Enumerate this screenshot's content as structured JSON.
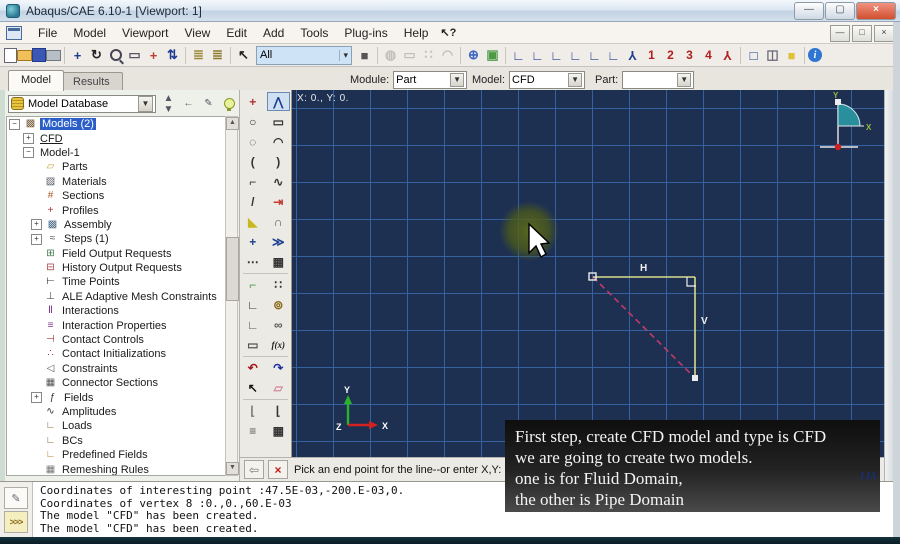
{
  "window": {
    "title": "Abaqus/CAE 6.10-1 [Viewport: 1]"
  },
  "menu_bar": {
    "items": [
      "File",
      "Model",
      "Viewport",
      "View",
      "Edit",
      "Add",
      "Tools",
      "Plug-ins",
      "Help"
    ],
    "context_help": "?"
  },
  "main_toolbar": {
    "selection_filter_value": "All",
    "items": [
      {
        "t": "icon",
        "name": "new-file-icon",
        "cls": "ic-page"
      },
      {
        "t": "icon",
        "name": "open-file-icon",
        "cls": "ic-folder"
      },
      {
        "t": "icon",
        "name": "save-icon",
        "cls": "ic-disk"
      },
      {
        "t": "icon",
        "name": "print-icon",
        "cls": "ic-printer"
      },
      {
        "t": "sep"
      },
      {
        "t": "icon",
        "name": "pan-view-icon",
        "g": "+",
        "c": "#1d3d8f"
      },
      {
        "t": "icon",
        "name": "rotate-view-icon",
        "g": "↻",
        "c": "#222222"
      },
      {
        "t": "icon",
        "name": "magnify-view-icon",
        "cls": "ic-zoom"
      },
      {
        "t": "icon",
        "name": "zoom-box-icon",
        "g": "▭",
        "c": "#556"
      },
      {
        "t": "icon",
        "name": "fit-view-icon",
        "g": "+",
        "c": "#c23b2e"
      },
      {
        "t": "icon",
        "name": "cycle-views-icon",
        "g": "⇅",
        "c": "#1d3d8f"
      },
      {
        "t": "sep"
      },
      {
        "t": "icon",
        "name": "query-ladder-icon",
        "g": "≣",
        "c": "#9a8a3a"
      },
      {
        "t": "icon",
        "name": "display-options-ladder-icon",
        "g": "≣",
        "c": "#8a7a2a"
      },
      {
        "t": "sep"
      },
      {
        "t": "icon",
        "name": "select-cursor-icon",
        "g": "↖",
        "c": "#222222"
      },
      {
        "t": "combo",
        "name": "selection-filter-combo"
      },
      {
        "t": "icon",
        "name": "color-code-icon",
        "g": "■",
        "c": "#555555"
      },
      {
        "t": "sep"
      },
      {
        "t": "icon",
        "name": "sphere-tool-icon",
        "g": "◍",
        "c": "#888888",
        "dis": true
      },
      {
        "t": "icon",
        "name": "capture-box-icon",
        "g": "▭",
        "c": "#888888",
        "dis": true
      },
      {
        "t": "icon",
        "name": "render-beads-icon",
        "g": "∷",
        "c": "#888888",
        "dis": true
      },
      {
        "t": "icon",
        "name": "lasso-icon",
        "g": "◠",
        "c": "#888888",
        "dis": true
      },
      {
        "t": "sep"
      },
      {
        "t": "icon",
        "name": "mesh-globe-icon",
        "g": "⊕",
        "c": "#3b66c4"
      },
      {
        "t": "icon",
        "name": "shaded-cube-icon",
        "g": "▣",
        "c": "#4d9a45"
      },
      {
        "t": "sep"
      },
      {
        "t": "icon",
        "name": "view-front-icon",
        "g": "∟",
        "c": "#1d3d8f"
      },
      {
        "t": "icon",
        "name": "view-back-icon",
        "g": "∟",
        "c": "#1d3d8f"
      },
      {
        "t": "icon",
        "name": "view-top-icon",
        "g": "∟",
        "c": "#1d3d8f"
      },
      {
        "t": "icon",
        "name": "view-bottom-icon",
        "g": "∟",
        "c": "#1d3d8f"
      },
      {
        "t": "icon",
        "name": "view-left-icon",
        "g": "∟",
        "c": "#1d3d8f"
      },
      {
        "t": "icon",
        "name": "view-right-icon",
        "g": "∟",
        "c": "#1d3d8f"
      },
      {
        "t": "icon",
        "name": "iso-view-triad-icon",
        "g": "Y",
        "c": "#1d3d8f",
        "cls": "flip"
      },
      {
        "t": "icon",
        "name": "viewport-1-button",
        "g": "1",
        "c": "#b02020",
        "cls": "num"
      },
      {
        "t": "icon",
        "name": "viewport-2-button",
        "g": "2",
        "c": "#b02020",
        "cls": "num"
      },
      {
        "t": "icon",
        "name": "viewport-3-button",
        "g": "3",
        "c": "#b02020",
        "cls": "num"
      },
      {
        "t": "icon",
        "name": "viewport-4-button",
        "g": "4",
        "c": "#b02020",
        "cls": "num"
      },
      {
        "t": "icon",
        "name": "triad-toggle-icon",
        "g": "Y",
        "c": "#b02020",
        "cls": "flip"
      },
      {
        "t": "sep"
      },
      {
        "t": "icon",
        "name": "wireframe-render-icon",
        "g": "□",
        "c": "#1d3d8f"
      },
      {
        "t": "icon",
        "name": "hiddenline-render-icon",
        "g": "◫",
        "c": "#667"
      },
      {
        "t": "icon",
        "name": "shaded-render-icon",
        "g": "■",
        "c": "#dfc23a"
      },
      {
        "t": "sep"
      },
      {
        "t": "icon",
        "name": "info-icon",
        "cls": "ic-info",
        "g": "i"
      }
    ]
  },
  "context_bar": {
    "tabs": [
      {
        "label": "Model",
        "active": true
      },
      {
        "label": "Results",
        "active": false
      }
    ],
    "module": {
      "label": "Module:",
      "value": "Part"
    },
    "model": {
      "label": "Model:",
      "value": "CFD"
    },
    "part": {
      "label": "Part:",
      "value": ""
    }
  },
  "model_tree": {
    "database_selector": "Model Database",
    "items": [
      {
        "label": "Models (2)",
        "depth": 0,
        "expander": "-",
        "selected": true,
        "icon": "models-icon",
        "g": "▩",
        "c": "#7a5a3a"
      },
      {
        "label": "CFD",
        "depth": 1,
        "expander": "+",
        "underline": true
      },
      {
        "label": "Model-1",
        "depth": 1,
        "expander": "-"
      },
      {
        "label": "Parts",
        "depth": 2,
        "icon": "parts-icon",
        "g": "▱",
        "c": "#c8a23a"
      },
      {
        "label": "Materials",
        "depth": 2,
        "icon": "materials-icon",
        "g": "▨",
        "c": "#556"
      },
      {
        "label": "Sections",
        "depth": 2,
        "icon": "sections-icon",
        "g": "#",
        "c": "#b05a2a"
      },
      {
        "label": "Profiles",
        "depth": 2,
        "icon": "profiles-icon",
        "g": "+",
        "c": "#b03030"
      },
      {
        "label": "Assembly",
        "depth": 2,
        "expander": "+",
        "icon": "assembly-icon",
        "g": "▩",
        "c": "#4a6a8a"
      },
      {
        "label": "Steps (1)",
        "depth": 2,
        "expander": "+",
        "icon": "steps-icon",
        "g": "≈",
        "c": "#555"
      },
      {
        "label": "Field Output Requests",
        "depth": 2,
        "icon": "field-output-icon",
        "g": "⊞",
        "c": "#3a7a4a"
      },
      {
        "label": "History Output Requests",
        "depth": 2,
        "icon": "history-output-icon",
        "g": "⊟",
        "c": "#a03a3a"
      },
      {
        "label": "Time Points",
        "depth": 2,
        "icon": "time-points-icon",
        "g": "⊢",
        "c": "#333"
      },
      {
        "label": "ALE Adaptive Mesh Constraints",
        "depth": 2,
        "icon": "ale-constraints-icon",
        "g": "⊥",
        "c": "#555"
      },
      {
        "label": "Interactions",
        "depth": 2,
        "icon": "interactions-icon",
        "g": "Ⅱ",
        "c": "#7a3a8a"
      },
      {
        "label": "Interaction Properties",
        "depth": 2,
        "icon": "interaction-properties-icon",
        "g": "≡",
        "c": "#7a3a8a"
      },
      {
        "label": "Contact Controls",
        "depth": 2,
        "icon": "contact-controls-icon",
        "g": "⊣",
        "c": "#a03a3a"
      },
      {
        "label": "Contact Initializations",
        "depth": 2,
        "icon": "contact-initializations-icon",
        "g": "∴",
        "c": "#a03a3a"
      },
      {
        "label": "Constraints",
        "depth": 2,
        "icon": "constraints-icon",
        "g": "◁",
        "c": "#555"
      },
      {
        "label": "Connector Sections",
        "depth": 2,
        "icon": "connector-sections-icon",
        "g": "▦",
        "c": "#555"
      },
      {
        "label": "Fields",
        "depth": 2,
        "expander": "+",
        "icon": "fields-icon",
        "g": "ƒ",
        "c": "#333"
      },
      {
        "label": "Amplitudes",
        "depth": 2,
        "icon": "amplitudes-icon",
        "g": "∿",
        "c": "#333"
      },
      {
        "label": "Loads",
        "depth": 2,
        "icon": "loads-icon",
        "g": "∟",
        "c": "#8a6b3a"
      },
      {
        "label": "BCs",
        "depth": 2,
        "icon": "bcs-icon",
        "g": "∟",
        "c": "#8a6b3a"
      },
      {
        "label": "Predefined Fields",
        "depth": 2,
        "icon": "predefined-fields-icon",
        "g": "∟",
        "c": "#c07a2a"
      },
      {
        "label": "Remeshing Rules",
        "depth": 2,
        "icon": "remeshing-rules-icon",
        "g": "▦",
        "c": "#777"
      }
    ]
  },
  "sketch_toolbox": {
    "items": [
      {
        "name": "sketch-point-tool",
        "g": "+",
        "c": "#b03030"
      },
      {
        "name": "sketch-lines-tool",
        "g": "⋀",
        "c": "#1d3d8f",
        "pressed": true
      },
      {
        "name": "sketch-circle-tool",
        "g": "○",
        "c": "#333"
      },
      {
        "name": "sketch-rectangle-tool",
        "g": "▭",
        "c": "#333"
      },
      {
        "name": "sketch-ellipse-tool",
        "g": "◌",
        "c": "#333"
      },
      {
        "name": "sketch-arc-3points-tool",
        "g": "◠",
        "c": "#333"
      },
      {
        "name": "sketch-arc-center-tool",
        "g": "(",
        "c": "#333"
      },
      {
        "name": "sketch-arc-tangent-tool",
        "g": ")",
        "c": "#333"
      },
      {
        "name": "sketch-fillet-tool",
        "g": "⌐",
        "c": "#333"
      },
      {
        "name": "sketch-spline-tool",
        "g": "∿",
        "c": "#333"
      },
      {
        "name": "sketch-line-tool",
        "g": "/",
        "c": "#333"
      },
      {
        "name": "sketch-construction-line-tool",
        "g": "⇥",
        "c": "#c23b2e"
      },
      {
        "name": "sketch-offset-tool",
        "g": "◣",
        "c": "#c8b820"
      },
      {
        "name": "sketch-project-edges-tool",
        "g": "∩",
        "c": "#555"
      },
      {
        "name": "sketch-add-dimension-tool",
        "g": "+",
        "c": "#1d3d8f"
      },
      {
        "name": "sketch-auto-dimension-tool",
        "g": "≫",
        "c": "#1d3d8f"
      },
      {
        "name": "sketch-edit-dimension-tool",
        "g": "⋯",
        "c": "#333"
      },
      {
        "name": "sketch-pattern-tool",
        "g": "▦",
        "c": "#333",
        "sepAfter": true
      },
      {
        "name": "sketch-options-tool",
        "g": "⌐",
        "c": "#4d9a45"
      },
      {
        "name": "sketch-grid-snap-tool",
        "g": "∷",
        "c": "#333"
      },
      {
        "name": "sketch-trim-tool",
        "g": "∟",
        "c": "#333"
      },
      {
        "name": "sketch-constraint-tool",
        "g": "⊚",
        "c": "#8a6b1a"
      },
      {
        "name": "sketch-merge-tool",
        "g": "∟",
        "c": "#555"
      },
      {
        "name": "sketch-measure-tool",
        "g": "∞",
        "c": "#555"
      },
      {
        "name": "sketch-drag-tool",
        "g": "▭",
        "c": "#555"
      },
      {
        "name": "sketch-parameter-tool",
        "fx": "f(x)",
        "c": "#222",
        "sepAfter": true
      },
      {
        "name": "sketch-undo-button",
        "g": "↶",
        "c": "#a01818"
      },
      {
        "name": "sketch-redo-button",
        "g": "↷",
        "c": "#2030a0"
      },
      {
        "name": "sketch-select-tool",
        "g": "↖",
        "c": "#111"
      },
      {
        "name": "sketch-delete-tool",
        "g": "▱",
        "c": "#d08a9a",
        "sepAfter": true
      },
      {
        "name": "sketch-save-sketch-tool",
        "g": "⌊",
        "c": "#777"
      },
      {
        "name": "sketch-reload-sketch-tool",
        "g": "⌊",
        "c": "#333"
      },
      {
        "name": "sketch-customize-tool",
        "g": "≡",
        "c": "#555"
      },
      {
        "name": "sketch-sketcher-grid-tool",
        "g": "▦",
        "c": "#333"
      }
    ]
  },
  "viewport": {
    "coords_readout": "X: 0.,  Y: 0.",
    "dim_h_label": "H",
    "dim_v_label": "V",
    "triad": {
      "x": "X",
      "y": "Y",
      "z": "Z"
    },
    "corner_sketch_labels": {
      "x": "X",
      "y": "Y"
    },
    "watermark": "LIA",
    "colors": {
      "background": "#1d3052",
      "grid": "#35619f",
      "sketch_line": "#d9dc8a",
      "rubber_band": "#c23b68",
      "highlight": "#4e5c17",
      "teal_fan": "#2a8f9c"
    }
  },
  "prompt_bar": {
    "text": "Pick an end point for the line--or enter X,Y:",
    "input_value": ""
  },
  "caption": {
    "lines": [
      "First step, create CFD model and type is CFD",
      "we are going to create two models.",
      "one is for Fluid Domain,",
      "the other is Pipe Domain"
    ]
  },
  "message_area": {
    "lines": [
      "Coordinates of interesting point :47.5E-03,-200.E-03,0.",
      "Coordinates of vertex 8 :0.,0.,60.E-03",
      "The model \"CFD\" has been created.",
      "The model \"CFD\" has been created."
    ]
  }
}
